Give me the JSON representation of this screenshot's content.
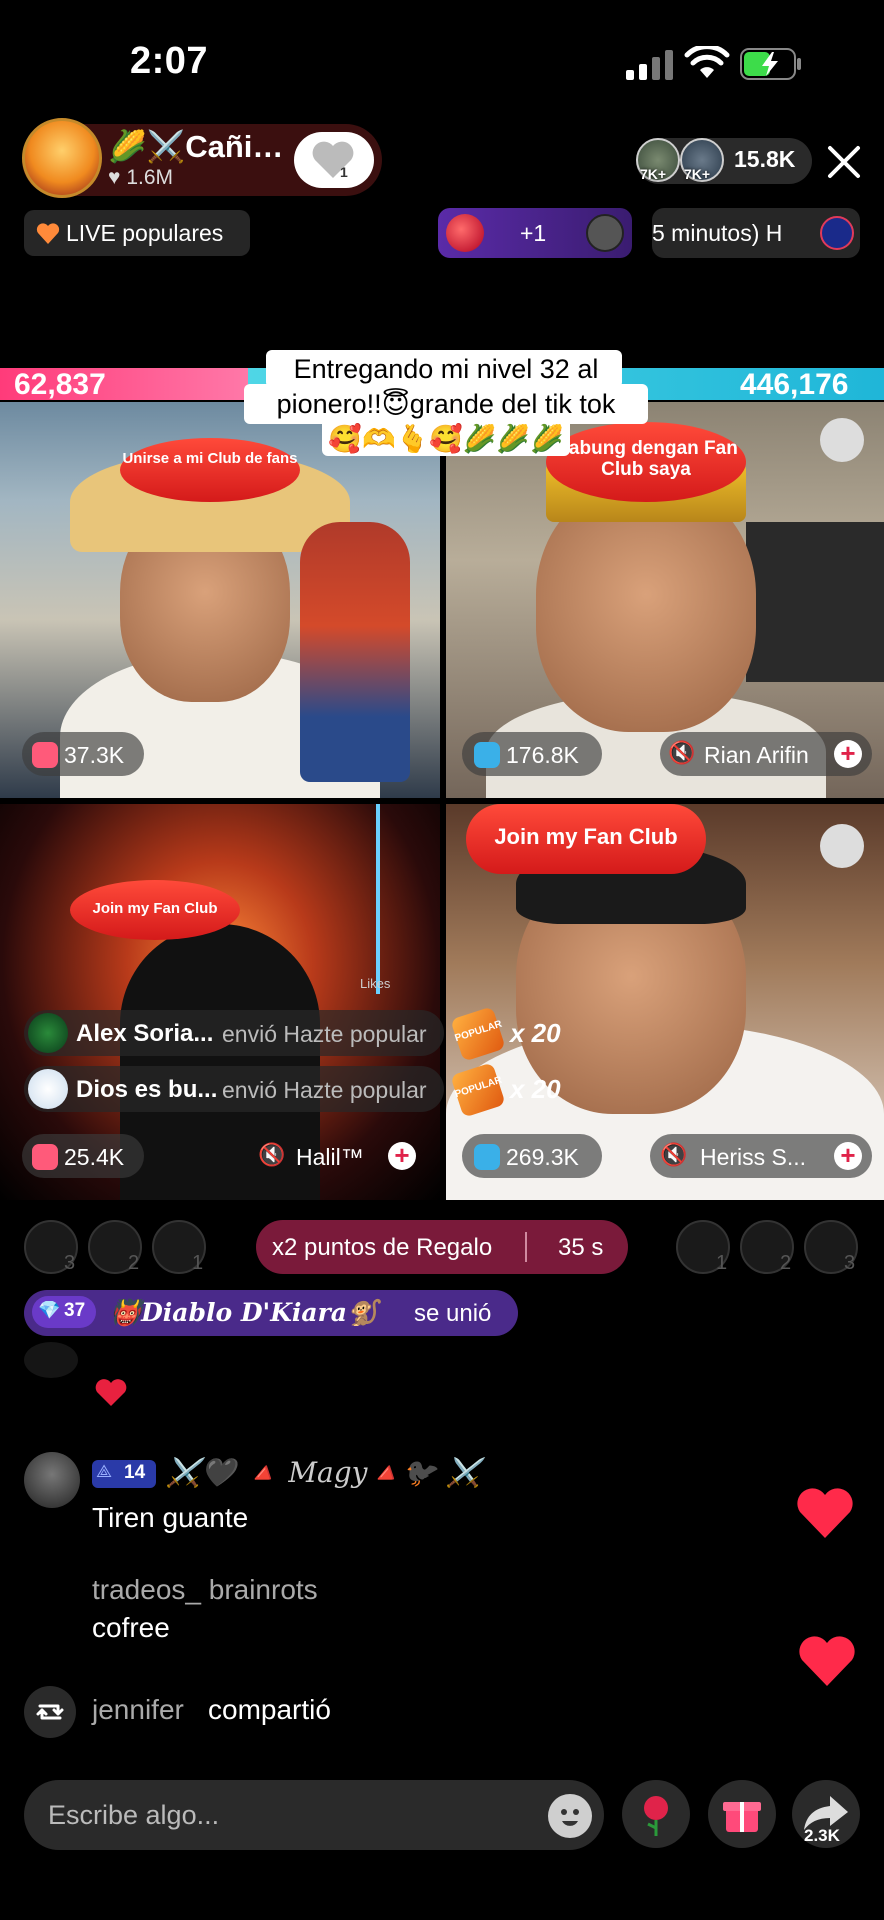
{
  "status": {
    "time": "2:07"
  },
  "host": {
    "name": "🌽⚔️Cañi…",
    "likes": "1.6M",
    "follow_count": "1"
  },
  "viewers": {
    "count": "15.8K",
    "badges": [
      "7K+",
      "7K+"
    ]
  },
  "pills": {
    "live_popular": "LIVE populares",
    "gift_plus": "+1",
    "timer": "5 minutos) H"
  },
  "battle": {
    "left_score": "62,837",
    "right_score": "446,176"
  },
  "caption": {
    "line1": "Entregando mi nivel 32 al",
    "line2": "pionero!!😇grande del tik tok",
    "line3": "🥰🫶🫰🥰🌽🌽🌽"
  },
  "tiles": [
    {
      "fanclub": "Unirse a mi Club de fans",
      "score": "37.3K"
    },
    {
      "fanclub": "Gabung dengan Fan Club saya",
      "score": "176.8K",
      "user": "Rian Arifin"
    },
    {
      "fanclub": "Join my Fan Club",
      "score": "25.4K",
      "user": "Halil™",
      "overlay": "Likes"
    },
    {
      "fanclub": "Join my Fan Club",
      "score": "269.3K",
      "user": "Heriss S..."
    }
  ],
  "gift_notices": [
    {
      "name": "Alex Soria...",
      "sent": "envió Hazte popular",
      "multiplier": "x 20",
      "badge": "POPULAR"
    },
    {
      "name": "Dios es bu...",
      "sent": "envió Hazte popular",
      "multiplier": "x 20",
      "badge": "POPULAR"
    }
  ],
  "ranks": {
    "left": [
      "3",
      "2",
      "1"
    ],
    "right": [
      "1",
      "2",
      "3"
    ]
  },
  "promo": {
    "label": "x2 puntos de Regalo",
    "time": "35 s"
  },
  "join": {
    "level": "37",
    "name": "👹𝑫𝒊𝒂𝒃𝒍𝒐 𝑫'𝑲𝒊𝒂𝒓𝒂🐒",
    "verb": "se unió"
  },
  "comments": [
    {
      "level": "14",
      "user": "⚔️🖤 🔺 Magy🔺🐦‍⬛ ⚔️",
      "text": "Tiren guante"
    },
    {
      "user": "tradeos_ brainrots",
      "text": "cofree"
    }
  ],
  "share": {
    "user": "jennifer",
    "verb": "compartió"
  },
  "input": {
    "placeholder": "Escribe algo..."
  },
  "actions": {
    "share_count": "2.3K"
  },
  "colors": {
    "battle_left": "#ff3b7a",
    "battle_right": "#1fb6d8",
    "promo_pill": "#7a1a3a",
    "join_pill": "#4a2a8a",
    "heart": "#ff2a4a"
  },
  "icons": [
    "signal-icon",
    "wifi-icon",
    "battery-charging-icon",
    "heart-icon",
    "close-icon",
    "fire-heart-icon",
    "clock-icon",
    "muted-icon",
    "plus-icon",
    "retweet-icon",
    "emoji-icon",
    "rose-icon",
    "gift-icon",
    "share-arrow-icon"
  ]
}
